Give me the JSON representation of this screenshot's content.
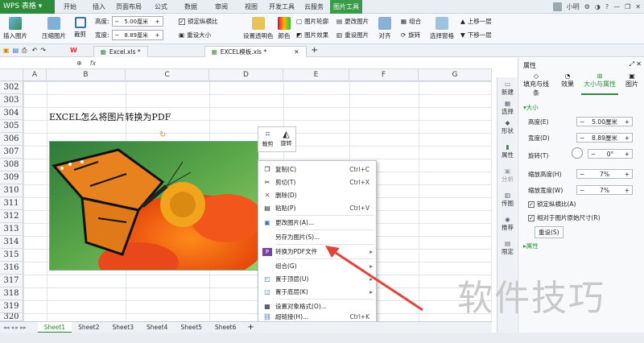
{
  "app": {
    "name": "WPS 表格"
  },
  "menu": [
    "开始",
    "插入",
    "页面布局",
    "公式",
    "数据",
    "审阅",
    "视图",
    "开发工具",
    "云服务",
    "图片工具"
  ],
  "window": {
    "user": "小明"
  },
  "ribbon": {
    "insert_picture": "插入图片",
    "compress": "压缩图片",
    "crop": "裁剪",
    "height_label": "高度:",
    "height_value": "5.00厘米",
    "width_label": "宽度:",
    "width_value": "8.89厘米",
    "lock_ratio": "锁定纵横比",
    "reset_size": "重设大小",
    "set_transparent": "设置透明色",
    "color": "颜色",
    "outline": "图片轮廓",
    "effect": "图片效果",
    "change_picture": "更改图片",
    "reset_picture": "重设图片",
    "align": "对齐",
    "group": "组合",
    "rotate": "旋转",
    "selection_pane": "选择窗格",
    "bring_forward": "上移一层",
    "send_backward": "下移一层"
  },
  "tabs": [
    {
      "label": "Excel.xls *",
      "active": false
    },
    {
      "label": "EXCEL模板.xls *",
      "active": true
    }
  ],
  "formula_bar": {
    "fx": "fx"
  },
  "columns": [
    "A",
    "B",
    "C",
    "D",
    "E",
    "F",
    "G"
  ],
  "rows": [
    "302",
    "303",
    "304",
    "305",
    "306",
    "307",
    "308",
    "309",
    "310",
    "311",
    "312",
    "313",
    "314",
    "315",
    "316",
    "317",
    "318",
    "319",
    "320"
  ],
  "cell_text": "EXCEL怎么将图片转换为PDF",
  "mini_toolbar": {
    "crop": "裁剪",
    "rotate": "旋转"
  },
  "context_menu": [
    {
      "label": "复制(C)",
      "shortcut": "Ctrl+C",
      "icon": "copy-icon"
    },
    {
      "label": "剪切(T)",
      "shortcut": "Ctrl+X",
      "icon": "cut-icon"
    },
    {
      "label": "删除(D)",
      "shortcut": "",
      "icon": "delete-icon"
    },
    {
      "label": "粘贴(P)",
      "shortcut": "Ctrl+V",
      "icon": "paste-icon"
    },
    {
      "label": "更改图片(A)...",
      "shortcut": "",
      "icon": "change-picture-icon"
    },
    {
      "label": "另存为图片(S)...",
      "shortcut": "",
      "icon": ""
    },
    {
      "label": "转换为PDF文件",
      "shortcut": "",
      "icon": "pdf-icon",
      "submenu": true
    },
    {
      "label": "组合(G)",
      "shortcut": "",
      "icon": "",
      "submenu": true
    },
    {
      "label": "置于顶层(U)",
      "shortcut": "",
      "icon": "bring-front-icon",
      "submenu": true
    },
    {
      "label": "置于底层(K)",
      "shortcut": "",
      "icon": "send-back-icon",
      "submenu": true
    },
    {
      "label": "设置对象格式(O)...",
      "shortcut": "",
      "icon": "format-icon"
    },
    {
      "label": "超链接(H)...",
      "shortcut": "Ctrl+K",
      "icon": "hyperlink-icon"
    }
  ],
  "sheets": [
    "Sheet1",
    "Sheet2",
    "Sheet3",
    "Sheet4",
    "Sheet5",
    "Sheet6"
  ],
  "right_sidebar": [
    "新建",
    "选择",
    "形状",
    "属性",
    "分析",
    "传图",
    "推荐",
    "限定"
  ],
  "panel": {
    "title": "属性",
    "tabs": [
      "填充与线条",
      "效果",
      "大小与属性",
      "图片"
    ],
    "section_size": "大小",
    "height_label": "高度(E)",
    "height_value": "5.00厘米",
    "width_label": "宽度(D)",
    "width_value": "8.89厘米",
    "rotation_label": "旋转(T)",
    "rotation_value": "0°",
    "scale_h_label": "缩放高度(H)",
    "scale_h_value": "7%",
    "scale_w_label": "缩放宽度(W)",
    "scale_w_value": "7%",
    "lock_ratio": "锁定纵横比(A)",
    "relative_size": "相对于图片原始尺寸(R)",
    "reset": "重设(S)",
    "section_props": "属性"
  },
  "watermark": "软件技巧",
  "colors": {
    "brand": "#2e8b3a",
    "arrow": "#e0453a"
  }
}
